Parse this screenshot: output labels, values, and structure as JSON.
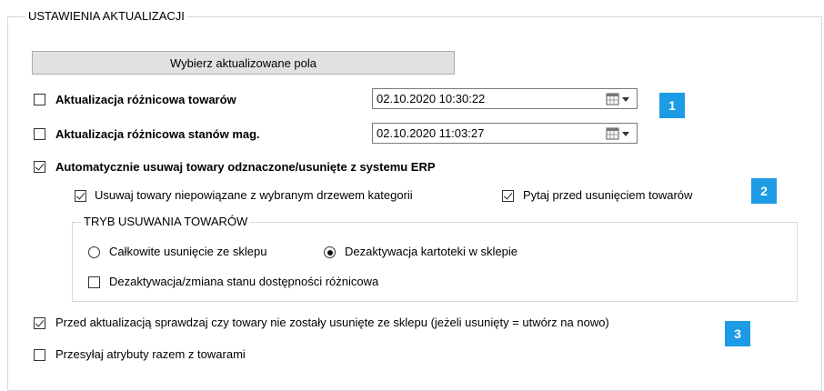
{
  "group_update": {
    "title": "USTAWIENIA AKTUALIZACJI"
  },
  "select_fields_button": "Wybierz aktualizowane pola",
  "diff_products": {
    "label": "Aktualizacja różnicowa towarów",
    "checked": false,
    "date": "02.10.2020 10:30:22"
  },
  "diff_stock": {
    "label": "Aktualizacja różnicowa stanów mag.",
    "checked": false,
    "date": "02.10.2020 11:03:27"
  },
  "auto_remove": {
    "label": "Automatycznie usuwaj towary odznaczone/usunięte z systemu ERP",
    "checked": true
  },
  "remove_unlinked": {
    "label": "Usuwaj towary niepowiązane z wybranym drzewem kategorii",
    "checked": true
  },
  "ask_before_remove": {
    "label": "Pytaj przed usunięciem towarów",
    "checked": true
  },
  "group_remove_mode": {
    "title": "TRYB USUWANIA TOWARÓW",
    "options": [
      {
        "label": "Całkowite usunięcie ze sklepu",
        "selected": false
      },
      {
        "label": "Dezaktywacja kartoteki w sklepie",
        "selected": true
      }
    ],
    "diff_deactivation": {
      "label": "Dezaktywacja/zmiana stanu dostępności różnicowa",
      "checked": false
    }
  },
  "check_deleted": {
    "label": "Przed aktualizacją sprawdzaj czy towary nie zostały usunięte ze sklepu (jeżeli usunięty = utwórz na nowo)",
    "checked": true
  },
  "send_attributes": {
    "label": "Przesyłaj atrybuty razem z towarami",
    "checked": false
  },
  "badges": [
    "1",
    "2",
    "3"
  ],
  "colors": {
    "badge": "#1e9be5",
    "border": "#d9d9d9",
    "button_bg": "#e1e1e1"
  },
  "icons": {
    "date_picker": "calendar-dropdown-icon"
  }
}
